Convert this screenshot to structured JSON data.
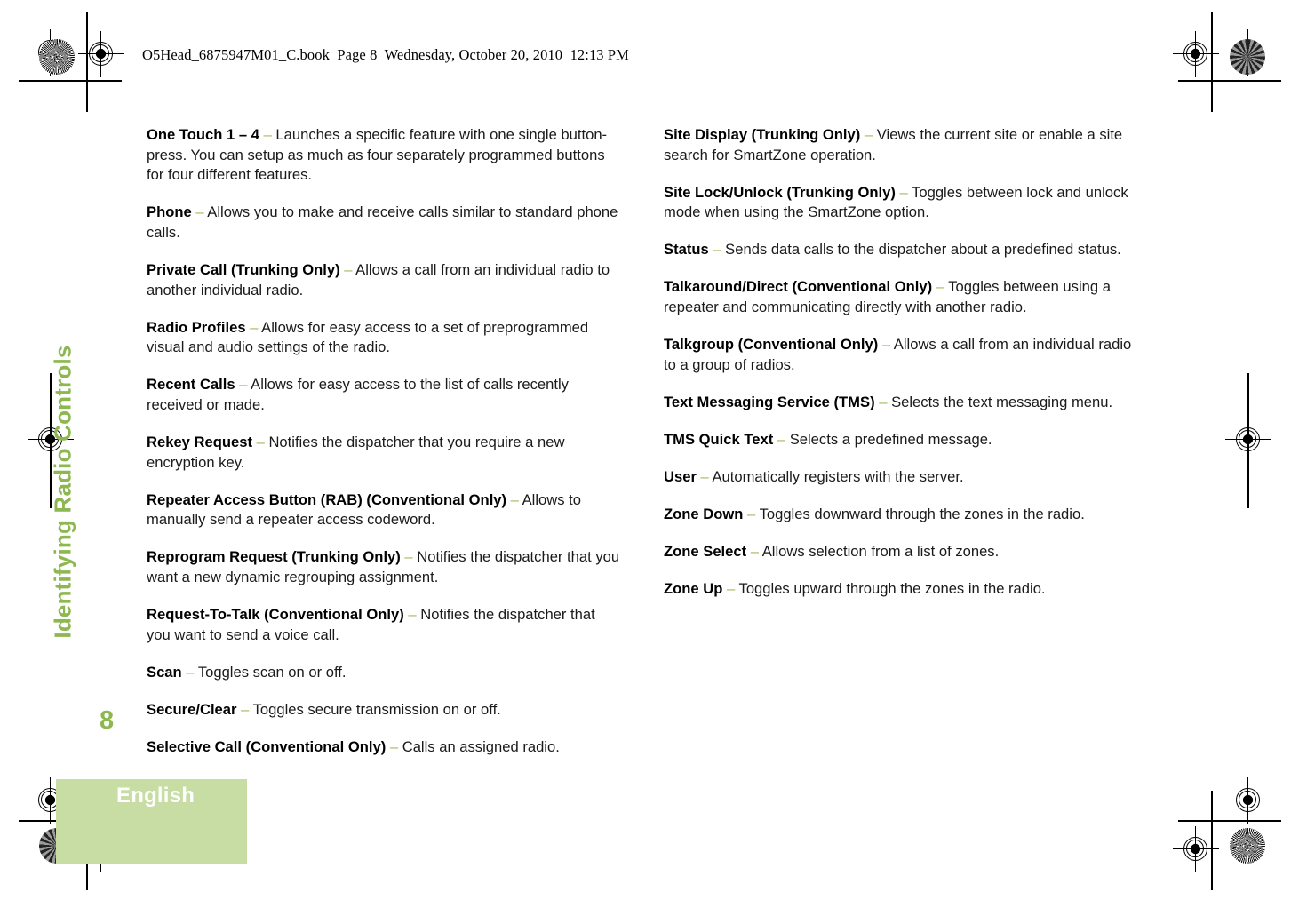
{
  "header": {
    "text": "O5Head_6875947M01_C.book  Page 8  Wednesday, October 20, 2010  12:13 PM"
  },
  "chapter": {
    "side_tab_title": "Identifying Radio Controls"
  },
  "footer": {
    "page_number": "8",
    "language": "English"
  },
  "colors": {
    "accent_green": "#8cb84f",
    "dash_green": "#9dbd5c",
    "block_green": "#c8dda4",
    "body_text": "#1a1a1a"
  },
  "separator": "–",
  "columns": {
    "left": [
      {
        "term": "One Touch 1 – 4",
        "desc": "Launches a specific feature with one single button-press. You can setup as much as four separately programmed buttons for four different features."
      },
      {
        "term": "Phone",
        "desc": "Allows you to make and receive calls similar to standard phone calls."
      },
      {
        "term": "Private Call (Trunking Only)",
        "desc": "Allows a call from an individual radio to another individual radio."
      },
      {
        "term": "Radio Profiles",
        "desc": "Allows for easy access to a set of preprogrammed visual and audio settings of the radio."
      },
      {
        "term": "Recent Calls",
        "desc": "Allows for easy access to the list of calls recently received or made."
      },
      {
        "term": "Rekey Request",
        "desc": "Notifies the dispatcher that you require a new encryption key."
      },
      {
        "term": "Repeater Access Button (RAB) (Conventional Only)",
        "desc": "Allows to manually send a repeater access codeword."
      },
      {
        "term": "Reprogram Request (Trunking Only)",
        "desc": "Notifies the dispatcher that you want a new dynamic regrouping assignment."
      },
      {
        "term": "Request-To-Talk (Conventional Only)",
        "desc": "Notifies the dispatcher that you want to send a voice call."
      },
      {
        "term": "Scan",
        "desc": "Toggles scan on or off."
      },
      {
        "term": "Secure/Clear",
        "desc": "Toggles secure transmission on or off."
      },
      {
        "term": "Selective Call (Conventional Only)",
        "desc": "Calls an assigned radio."
      }
    ],
    "right": [
      {
        "term": "Site Display (Trunking Only)",
        "desc": "Views the current site or enable a site search for SmartZone operation."
      },
      {
        "term": "Site Lock/Unlock (Trunking Only)",
        "desc": "Toggles between lock and unlock mode when using the SmartZone option."
      },
      {
        "term": "Status",
        "desc": "Sends data calls to the dispatcher about a predefined status."
      },
      {
        "term": "Talkaround/Direct (Conventional Only)",
        "desc": "Toggles between using a repeater and communicating directly with another radio."
      },
      {
        "term": "Talkgroup (Conventional Only)",
        "desc": "Allows a call from an individual radio to a group of radios."
      },
      {
        "term": "Text Messaging Service (TMS)",
        "desc": "Selects the text messaging menu."
      },
      {
        "term": "TMS Quick Text",
        "desc": "Selects a predefined message."
      },
      {
        "term": "User",
        "desc": "Automatically registers with the server."
      },
      {
        "term": "Zone Down",
        "desc": "Toggles downward through the zones in the radio."
      },
      {
        "term": "Zone Select",
        "desc": "Allows selection from a list of zones."
      },
      {
        "term": "Zone Up",
        "desc": "Toggles upward through the zones in the radio."
      }
    ]
  }
}
